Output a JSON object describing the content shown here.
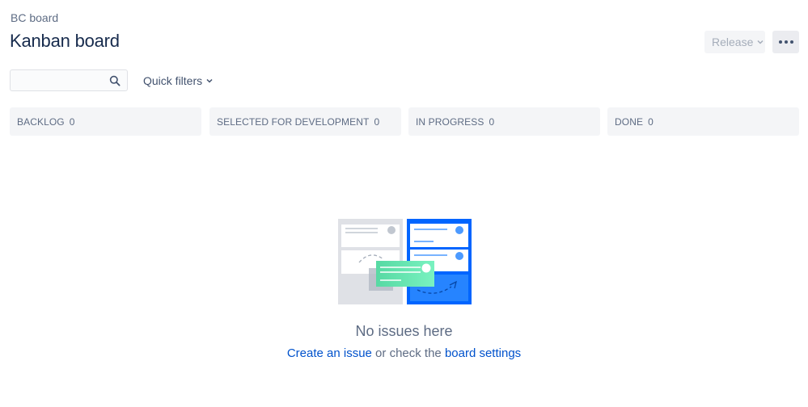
{
  "header": {
    "breadcrumb": "BC board",
    "title": "Kanban board",
    "release_label": "Release",
    "more_label": "More actions"
  },
  "filters": {
    "search_value": "",
    "search_placeholder": "",
    "quick_filters_label": "Quick filters"
  },
  "columns": [
    {
      "name": "BACKLOG",
      "count": "0"
    },
    {
      "name": "SELECTED FOR DEVELOPMENT",
      "count": "0"
    },
    {
      "name": "IN PROGRESS",
      "count": "0"
    },
    {
      "name": "DONE",
      "count": "0"
    }
  ],
  "empty_state": {
    "title": "No issues here",
    "create_link": "Create an issue",
    "middle_text": " or check the ",
    "settings_link": "board settings"
  },
  "colors": {
    "accent_blue": "#0065ff",
    "link_blue": "#0052cc",
    "green_card": "#57d9a3",
    "column_bg": "#f4f5f7"
  },
  "icons": {
    "search": "search-icon",
    "chevron": "chevron-down-icon",
    "more": "more-icon",
    "illustration": "empty-board-illustration"
  }
}
